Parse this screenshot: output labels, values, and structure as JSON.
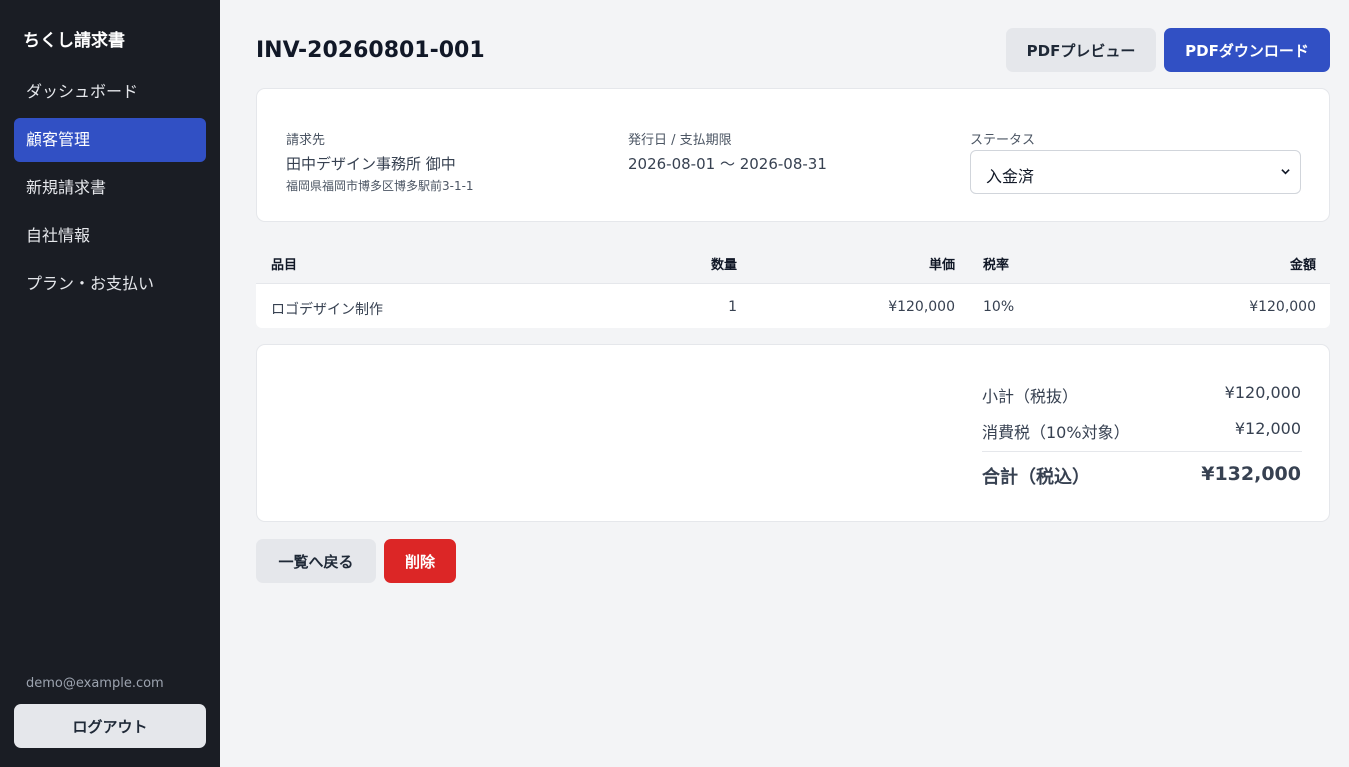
{
  "app": {
    "brand": "ちくし請求書"
  },
  "sidebar": {
    "items": [
      {
        "label": "ダッシュボード"
      },
      {
        "label": "顧客管理"
      },
      {
        "label": "新規請求書"
      },
      {
        "label": "自社情報"
      },
      {
        "label": "プラン・お支払い"
      }
    ],
    "user_email": "demo@example.com",
    "logout_label": "ログアウト"
  },
  "header": {
    "invoice_no": "INV-20260801-001",
    "pdf_preview_label": "PDFプレビュー",
    "pdf_download_label": "PDFダウンロード"
  },
  "info": {
    "billing_label": "請求先",
    "billing_name": "田中デザイン事務所 御中",
    "billing_address": "福岡県福岡市博多区博多駅前3-1-1",
    "dates_label": "発行日 / 支払期限",
    "dates_value": "2026-08-01 〜 2026-08-31",
    "status_label": "ステータス",
    "status_value": "入金済"
  },
  "table": {
    "headers": {
      "item": "品目",
      "qty": "数量",
      "unit_price": "単価",
      "tax_rate": "税率",
      "amount": "金額"
    },
    "rows": [
      {
        "item": "ロゴデザイン制作",
        "qty": "1",
        "unit_price": "¥120,000",
        "tax_rate": "10%",
        "amount": "¥120,000"
      }
    ]
  },
  "summary": {
    "subtotal_label": "小計（税抜）",
    "subtotal_value": "¥120,000",
    "tax_label": "消費税（10%対象）",
    "tax_value": "¥12,000",
    "total_label": "合計（税込）",
    "total_value": "¥132,000"
  },
  "actions": {
    "back_label": "一覧へ戻る",
    "delete_label": "削除"
  },
  "colors": {
    "primary": "#3150c4",
    "danger": "#dc2626",
    "sidebar_bg": "#1a1d24"
  }
}
